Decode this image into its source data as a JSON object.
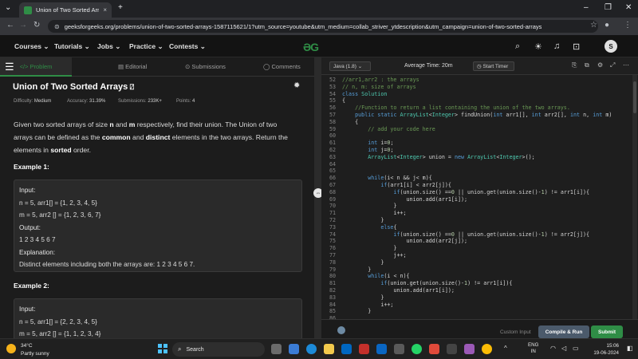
{
  "browser": {
    "tab_title": "Union of Two Sorted Arrays | Pr...",
    "tab_close": "×",
    "new_tab": "+",
    "url": "geeksforgeeks.org/problems/union-of-two-sorted-arrays-1587115621/1?utm_source=youtube&utm_medium=collab_striver_ytdescription&utm_campaign=union-of-two-sorted-arrays"
  },
  "site": {
    "menu": [
      "Courses ⌄",
      "Tutorials ⌄",
      "Jobs ⌄",
      "Practice ⌄",
      "Contests ⌄"
    ],
    "logo": "ƏG",
    "avatar_letter": "S"
  },
  "left_tabs": {
    "problem": "</> Problem",
    "editorial": "▤ Editorial",
    "submissions": "⊙ Submissions",
    "comments": "◯ Comments"
  },
  "problem": {
    "title": "Union of Two Sorted Arrays",
    "difficulty_label": "Difficulty:",
    "difficulty": "Medium",
    "accuracy_label": "Accuracy:",
    "accuracy": "31.39%",
    "submissions_label": "Submissions:",
    "submissions": "233K+",
    "points_label": "Points:",
    "points": "4",
    "desc_1": "Given two sorted arrays of size ",
    "desc_n": "n",
    "desc_2": " and ",
    "desc_m": "m",
    "desc_3": " respectively, find their union. The Union of two arrays can be defined as the ",
    "desc_common": "common",
    "desc_4": " and ",
    "desc_distinct": "distinct",
    "desc_5": " elements in the two arrays. Return the elements in ",
    "desc_sorted": "sorted",
    "desc_6": " order."
  },
  "example1": {
    "heading": "Example 1:",
    "lines": [
      "Input:",
      "n = 5, arr1[] = {1, 2, 3, 4, 5}",
      "m = 5, arr2 [] = {1, 2, 3, 6, 7}",
      "Output:",
      "1 2 3 4 5 6 7",
      "Explanation:",
      "Distinct elements including both the arrays are: 1 2 3 4 5 6 7."
    ]
  },
  "example2": {
    "heading": "Example 2:",
    "lines": [
      "Input:",
      "n = 5, arr1[] = {2, 2, 3, 4, 5}",
      "m = 5, arr2 [] = {1, 1, 2, 3, 4}"
    ]
  },
  "editor": {
    "language": "Java (1.8)   ⌄",
    "avg_time": "Average Time: 20m",
    "timer": "◷ Start Timer",
    "custom_input": "Custom Input",
    "compile": "Compile & Run",
    "submit": "Submit",
    "code": [
      {
        "n": "52",
        "t": "//arr1,arr2 : the arrays"
      },
      {
        "n": "53",
        "t": "// n, m: size of arrays"
      },
      {
        "n": "54",
        "t": "class Solution"
      },
      {
        "n": "55",
        "t": "{"
      },
      {
        "n": "56",
        "t": "    //Function to return a list containing the union of the two arrays."
      },
      {
        "n": "57",
        "t": "    public static ArrayList<Integer> findUnion(int arr1[], int arr2[], int n, int m)"
      },
      {
        "n": "58",
        "t": "    {"
      },
      {
        "n": "59",
        "t": "        // add your code here"
      },
      {
        "n": "60",
        "t": ""
      },
      {
        "n": "61",
        "t": "        int i=0;"
      },
      {
        "n": "62",
        "t": "        int j=0;"
      },
      {
        "n": "63",
        "t": "        ArrayList<Integer> union = new ArrayList<Integer>();"
      },
      {
        "n": "64",
        "t": ""
      },
      {
        "n": "65",
        "t": ""
      },
      {
        "n": "66",
        "t": "        while(i< n && j< m){"
      },
      {
        "n": "67",
        "t": "            if(arr1[i] < arr2[j]){"
      },
      {
        "n": "68",
        "t": "                if(union.size() ==0 || union.get(union.size()-1) != arr1[i]){"
      },
      {
        "n": "69",
        "t": "                    union.add(arr1[i]);"
      },
      {
        "n": "70",
        "t": "                }"
      },
      {
        "n": "71",
        "t": "                i++;"
      },
      {
        "n": "72",
        "t": "            }"
      },
      {
        "n": "73",
        "t": "            else{"
      },
      {
        "n": "74",
        "t": "                if(union.size() ==0 || union.get(union.size()-1) != arr2[j]){"
      },
      {
        "n": "75",
        "t": "                    union.add(arr2[j]);"
      },
      {
        "n": "76",
        "t": "                }"
      },
      {
        "n": "77",
        "t": "                j++;"
      },
      {
        "n": "78",
        "t": "            }"
      },
      {
        "n": "79",
        "t": "        }"
      },
      {
        "n": "80",
        "t": "        while(i < n){"
      },
      {
        "n": "81",
        "t": "            if(union.get(union.size()-1) != arr1[i]){"
      },
      {
        "n": "82",
        "t": "                union.add(arr1[i]);"
      },
      {
        "n": "83",
        "t": "            }"
      },
      {
        "n": "84",
        "t": "            i++;"
      },
      {
        "n": "85",
        "t": "        }"
      },
      {
        "n": "86",
        "t": ""
      },
      {
        "n": "87",
        "t": "        while(j< m){"
      },
      {
        "n": "88",
        "t": "            if(union.get(union.size()-1) != arr2[j]){"
      }
    ]
  },
  "taskbar": {
    "temp": "34°C",
    "weather": "Partly sunny",
    "search": "Search",
    "lang1": "ENG",
    "lang2": "IN",
    "time": "15:06",
    "date": "19-06-2024",
    "tray_chevron": "^"
  },
  "colors": {
    "accent": "#2f8d46",
    "submit": "#2f8d46",
    "compile": "#4b5a6b"
  }
}
